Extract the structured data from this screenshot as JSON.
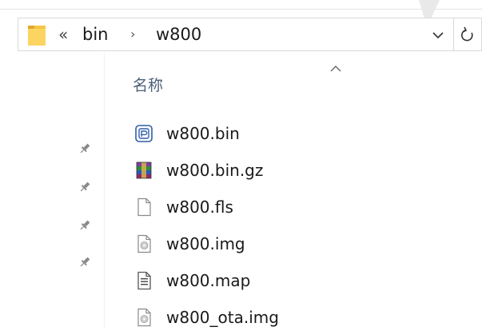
{
  "address_bar": {
    "overflow_chevron": "«",
    "path": [
      "bin",
      "w800"
    ],
    "separator": "›"
  },
  "column_header": {
    "name_label": "名称"
  },
  "files": [
    {
      "name": "w800.bin",
      "icon": "disc-image-icon",
      "pinned": false
    },
    {
      "name": "w800.bin.gz",
      "icon": "winrar-archive-icon",
      "pinned": true
    },
    {
      "name": "w800.fls",
      "icon": "blank-file-icon",
      "pinned": true
    },
    {
      "name": "w800.img",
      "icon": "img-file-icon",
      "pinned": true
    },
    {
      "name": "w800.map",
      "icon": "text-file-icon",
      "pinned": true
    },
    {
      "name": "w800_ota.img",
      "icon": "img-file-icon",
      "pinned": false
    }
  ],
  "colors": {
    "header_text": "#4c607a",
    "folder_yellow": "#f6c645",
    "border": "#d9d9d9"
  }
}
